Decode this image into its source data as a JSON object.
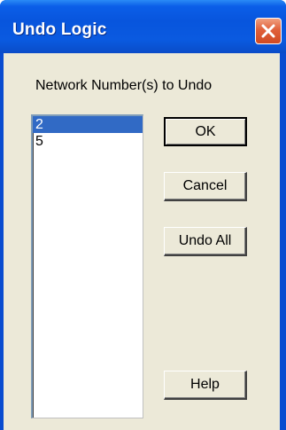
{
  "window": {
    "title": "Undo Logic"
  },
  "dialog": {
    "prompt": "Network Number(s) to Undo",
    "network_list": [
      {
        "label": "2",
        "selected": true
      },
      {
        "label": "5",
        "selected": false
      }
    ],
    "buttons": {
      "ok_label": "OK",
      "cancel_label": "Cancel",
      "undo_all_label": "Undo All",
      "help_label": "Help"
    }
  },
  "icons": {
    "close": "close-icon"
  },
  "colors": {
    "titlebar": "#0855dd",
    "dialog_face": "#ece9d8",
    "selection": "#316ac5",
    "close_button": "#e0603a"
  }
}
